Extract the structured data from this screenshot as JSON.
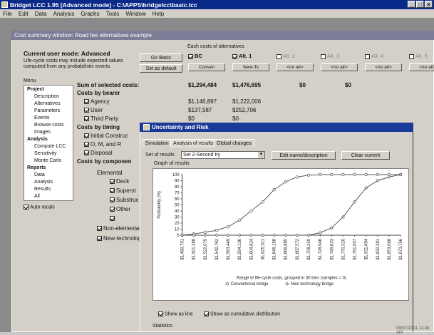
{
  "window": {
    "title": "Bridget LCC 1.95 [Advanced mode] - C:\\APPS\\bridgelcc\\basic.lcc",
    "menu": [
      "File",
      "Edit",
      "Data",
      "Analysis",
      "Graphs",
      "Tools",
      "Window",
      "Help"
    ],
    "controls": [
      "_",
      "□",
      "×"
    ]
  },
  "inner": {
    "title": "Cost summary window: Road fee alternatives example",
    "mode": "Current user mode: Advanced",
    "note": "Life-cycle costs may include expected values computed from any probabilistic events",
    "go_basic": "Go Basic",
    "set_default": "Set as default",
    "each_costs": "Each costs of alternatives",
    "alternatives": [
      {
        "name": "BC",
        "checked": true,
        "btn": "Conven"
      },
      {
        "name": "Alt. 1",
        "checked": true,
        "btn": "New-Ts"
      },
      {
        "name": "Alt. 2",
        "checked": false,
        "btn": "<no alt>"
      },
      {
        "name": "Alt. 3",
        "checked": false,
        "btn": "<no alt>"
      },
      {
        "name": "Alt. 4",
        "checked": false,
        "btn": "<no alt>"
      },
      {
        "name": "Alt. 5",
        "checked": false,
        "btn": "<no alt>"
      }
    ],
    "menu_label": "Menu",
    "tree": [
      {
        "t": "Project",
        "b": true,
        "i": 0
      },
      {
        "t": "Description",
        "b": false,
        "i": 1
      },
      {
        "t": "Alternatives",
        "b": false,
        "i": 1
      },
      {
        "t": "Parameters",
        "b": false,
        "i": 1
      },
      {
        "t": "Events",
        "b": false,
        "i": 1
      },
      {
        "t": "Browse costs",
        "b": false,
        "i": 1
      },
      {
        "t": "Images",
        "b": false,
        "i": 1
      },
      {
        "t": "Analysis",
        "b": true,
        "i": 0
      },
      {
        "t": "Compute LCC",
        "b": false,
        "i": 1
      },
      {
        "t": "Sensitivity",
        "b": false,
        "i": 1
      },
      {
        "t": "Monte Carlo",
        "b": false,
        "i": 1
      },
      {
        "t": "Reports",
        "b": true,
        "i": 0
      },
      {
        "t": "Data",
        "b": false,
        "i": 1
      },
      {
        "t": "Analysis",
        "b": false,
        "i": 1
      },
      {
        "t": "Results",
        "b": false,
        "i": 1
      },
      {
        "t": "All",
        "b": false,
        "i": 1
      }
    ],
    "auto_recalc": "Auto recalc",
    "sum_label": "Sum of selected costs:",
    "sum_values": [
      "$1,294,484",
      "$1,476,695",
      "$0",
      "$0"
    ],
    "bearer_label": "Costs by bearer",
    "bearer_rows": [
      {
        "name": "Agency",
        "v1": "$1,146,897",
        "v2": "$1,222,006"
      },
      {
        "name": "User",
        "v1": "$137,587",
        "v2": "$252,706"
      },
      {
        "name": "Third Party",
        "v1": "$0",
        "v2": "$0"
      }
    ],
    "timing_label": "Costs by timing",
    "timing_rows": [
      "Initial Construc",
      "O, M, and R",
      "Disposal"
    ],
    "component_label": "Costs by componen",
    "elemental_label": "Elemental",
    "component_rows": [
      "Deck",
      "Superst",
      "Substruc",
      "Other",
      ""
    ],
    "non_elemental": "Non-elemental",
    "new_tech": "New-technolog"
  },
  "dialog": {
    "title": "Uncertainty and Risk",
    "tabs": [
      "Simulation",
      "Analysis of results",
      "Global changes"
    ],
    "set_label": "Set of results",
    "set_value": "Set 2-Second try",
    "edit_btn": "Edit name/description",
    "clear_btn": "Clear current",
    "graph_label": "Graph of results",
    "show_line": "Show as line",
    "show_cum": "Show as cumulative distribution",
    "statistics": "Statistics"
  },
  "chart_data": {
    "type": "line",
    "ylabel": "Probability (%)",
    "xlabel": "Range of life-cycle costs, grouped in 30 bins (samples = 0)",
    "ylim": [
      0,
      100
    ],
    "yticks": [
      0,
      10,
      20,
      30,
      40,
      50,
      60,
      70,
      80,
      90,
      100
    ],
    "categories": [
      "$1,480,701",
      "$1,501,388",
      "$1,522,075",
      "$1,542,762",
      "$1,563,449",
      "$1,584,136",
      "$1,604,824",
      "$1,625,511",
      "$1,646,198",
      "$1,666,885",
      "$1,687,572",
      "$1,708,259",
      "$1,728,946",
      "$1,749,633",
      "$1,770,320",
      "$1,791,007",
      "$1,811,694",
      "$1,832,381",
      "$1,853,068",
      "$1,873,756"
    ],
    "series": [
      {
        "name": "Conventional bridge",
        "color": "#444444",
        "values": [
          0,
          2,
          5,
          8,
          14,
          25,
          40,
          55,
          75,
          88,
          96,
          99,
          100,
          100,
          100,
          100,
          100,
          100,
          100,
          100
        ]
      },
      {
        "name": "New technology bridge",
        "color": "#444444",
        "values": [
          0,
          0,
          0,
          0,
          0,
          0,
          0,
          0,
          0,
          0,
          0,
          0,
          4,
          12,
          30,
          55,
          78,
          90,
          96,
          100
        ]
      }
    ],
    "legend": "bottom-center"
  },
  "status": "09/07/2001 11:48 AM"
}
